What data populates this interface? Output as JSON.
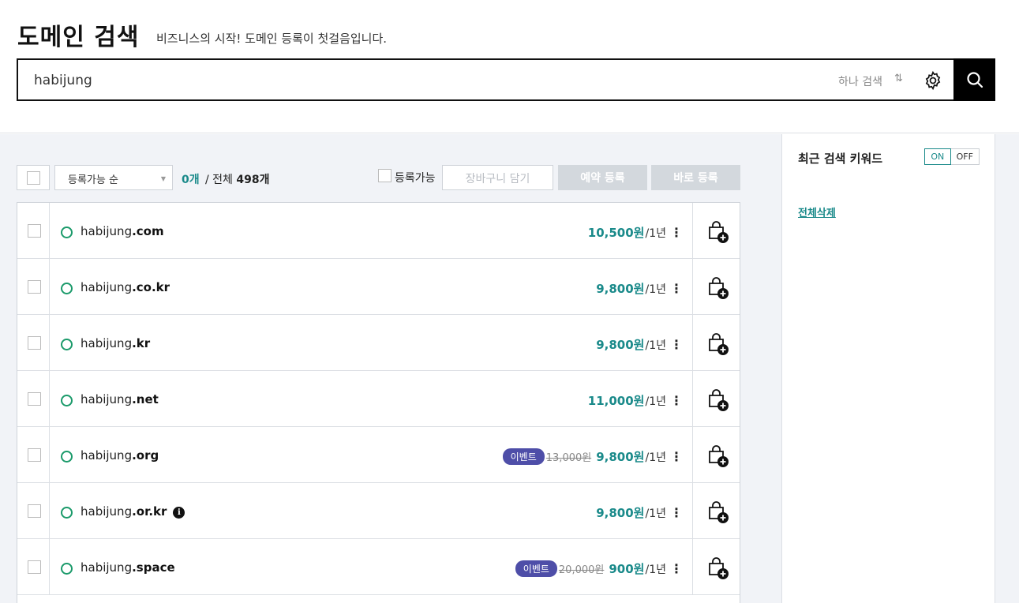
{
  "header": {
    "title": "도메인 검색",
    "subtitle": "비즈니스의 시작! 도메인 등록이 첫걸음입니다.",
    "search_value": "habijung",
    "search_mode": "하나 검색",
    "swap_glyph": "⇅"
  },
  "toolbar": {
    "sort_label": "등록가능 순",
    "selected_count": "0개",
    "total_label_prefix": "/ 전체 ",
    "total_count": "498개",
    "available_label": "등록가능",
    "cart_label": "장바구니 담기",
    "reserve_label": "예약 등록",
    "register_label": "바로 등록"
  },
  "results": [
    {
      "name": "habijung",
      "tld": ".com",
      "event": "",
      "old_price": "",
      "price": "10,500",
      "unit": "원",
      "period": "/1년",
      "info": false
    },
    {
      "name": "habijung",
      "tld": ".co.kr",
      "event": "",
      "old_price": "",
      "price": "9,800",
      "unit": "원",
      "period": "/1년",
      "info": false
    },
    {
      "name": "habijung",
      "tld": ".kr",
      "event": "",
      "old_price": "",
      "price": "9,800",
      "unit": "원",
      "period": "/1년",
      "info": false
    },
    {
      "name": "habijung",
      "tld": ".net",
      "event": "",
      "old_price": "",
      "price": "11,000",
      "unit": "원",
      "period": "/1년",
      "info": false
    },
    {
      "name": "habijung",
      "tld": ".org",
      "event": "이벤트",
      "old_price": "13,000원",
      "price": "9,800",
      "unit": "원",
      "period": "/1년",
      "info": false
    },
    {
      "name": "habijung",
      "tld": ".or.kr",
      "event": "",
      "old_price": "",
      "price": "9,800",
      "unit": "원",
      "period": "/1년",
      "info": true,
      "info_glyph": "i"
    },
    {
      "name": "habijung",
      "tld": ".space",
      "event": "이벤트",
      "old_price": "20,000원",
      "price": "900",
      "unit": "원",
      "period": "/1년",
      "info": false
    }
  ],
  "sidebar": {
    "title": "최근 검색 키워드",
    "toggle_on": "ON",
    "toggle_off": "OFF",
    "delete_all": "전체삭제"
  },
  "colors": {
    "accent": "#1a8a8a",
    "status_available": "#1a9a6a",
    "event_badge": "#4e4ea8",
    "disabled_button": "#d3d8dd"
  }
}
